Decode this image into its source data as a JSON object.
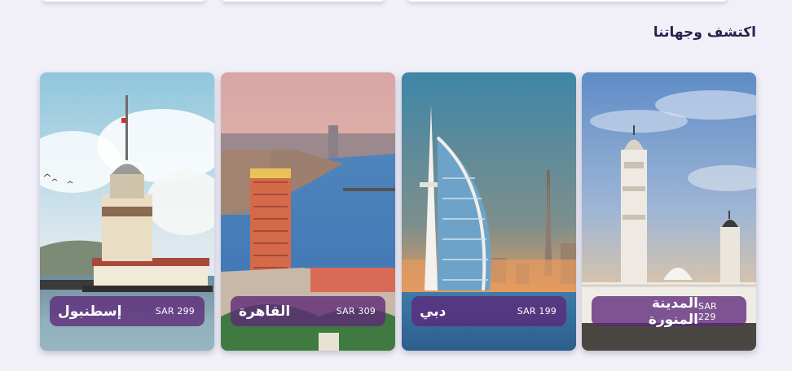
{
  "section": {
    "title": "اكتشف وجهاتنا"
  },
  "destinations": [
    {
      "city": "إسطنبول",
      "price": "SAR 299",
      "image": "maidens-tower-istanbul"
    },
    {
      "city": "القاهرة",
      "price": "SAR 309",
      "image": "cairo-nile-skyline"
    },
    {
      "city": "دبي",
      "price": "SAR 199",
      "image": "burj-al-arab-dubai"
    },
    {
      "city": "المدينة المنورة",
      "price": "SAR 229",
      "image": "quba-mosque-madinah"
    }
  ],
  "colors": {
    "background": "#f1f0f9",
    "pill": "#5c2878",
    "title": "#2c1f4d"
  }
}
